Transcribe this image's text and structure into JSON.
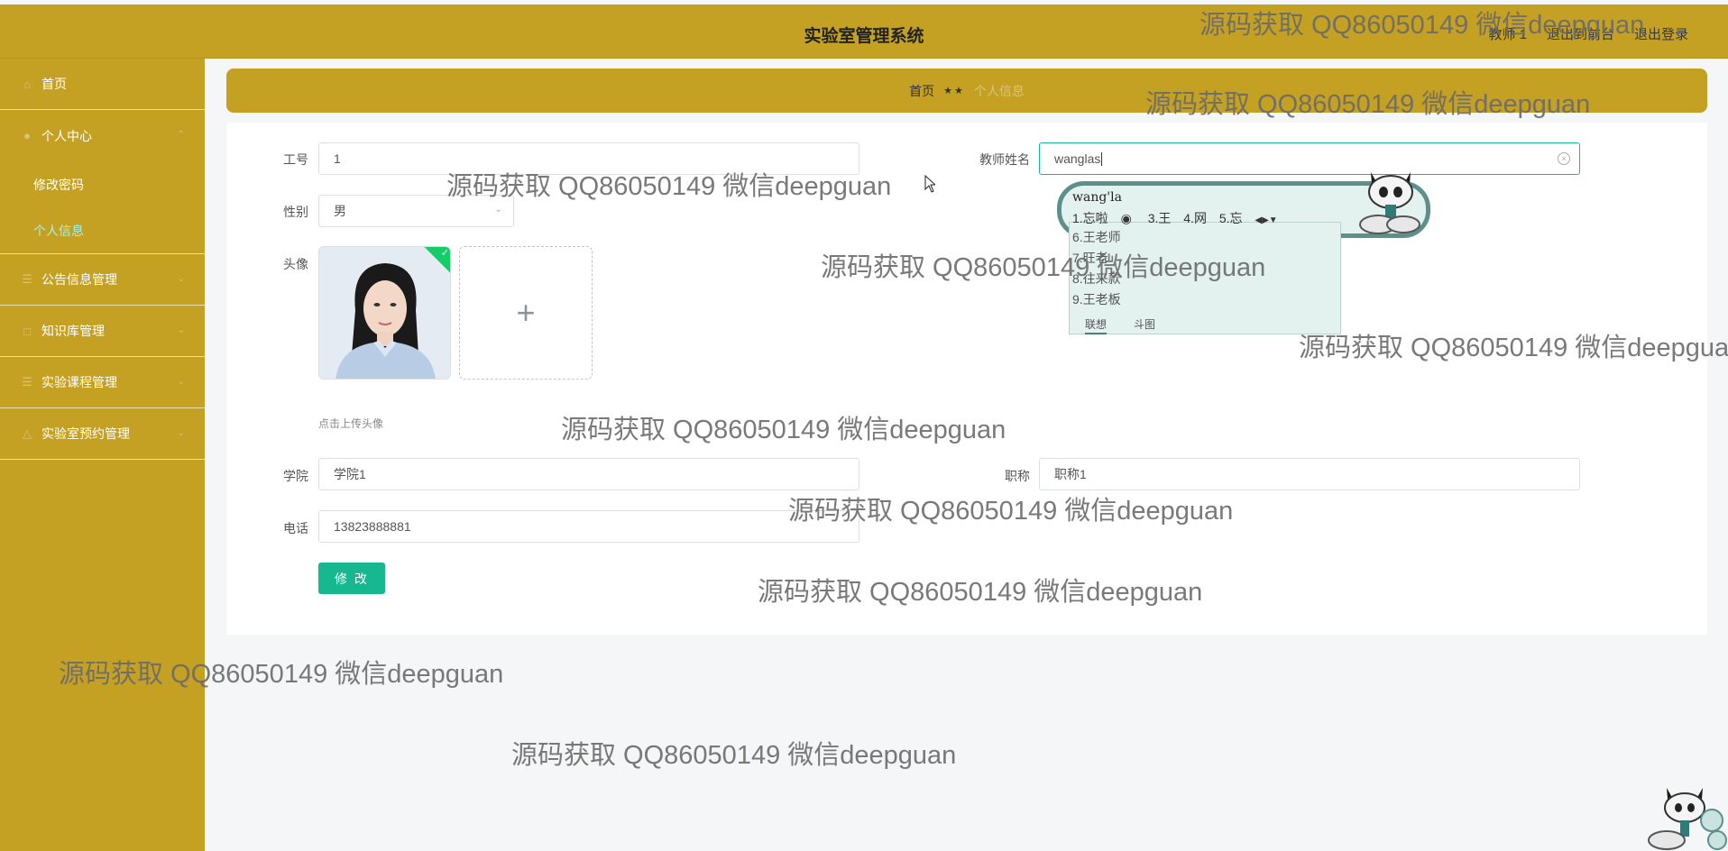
{
  "header": {
    "title": "实验室管理系统",
    "links": [
      "教师 1",
      "退出到前台",
      "退出登录"
    ]
  },
  "sidebar": {
    "items": [
      {
        "label": "首页",
        "icon": "home-icon"
      },
      {
        "label": "个人中心",
        "icon": "user-icon"
      },
      {
        "label": "公告信息管理",
        "icon": "list-icon"
      },
      {
        "label": "知识库管理",
        "icon": "book-icon"
      },
      {
        "label": "实验课程管理",
        "icon": "list-icon"
      },
      {
        "label": "实验室预约管理",
        "icon": "flask-icon"
      }
    ],
    "personal_sub": [
      "修改密码",
      "个人信息"
    ]
  },
  "breadcrumb": {
    "home": "首页",
    "separator": "★★",
    "current": "个人信息"
  },
  "form": {
    "id_label": "工号",
    "id_value": "1",
    "name_label": "教师姓名",
    "name_value": "wanglas",
    "gender_label": "性别",
    "gender_value": "男",
    "avatar_label": "头像",
    "upload_tip": "点击上传头像",
    "college_label": "学院",
    "college_value": "学院1",
    "title_label": "职称",
    "title_value": "职称1",
    "phone_label": "电话",
    "phone_value": "13823888881",
    "submit_label": "修 改"
  },
  "ime": {
    "pinyin": "wang'la",
    "first_row": [
      "1.忘啦",
      "3.王",
      "4.网",
      "5.忘"
    ],
    "candidates": [
      "6.王老师",
      "7.旺老",
      "8.往来款",
      "9.王老板"
    ],
    "tabs": [
      "联想",
      "斗图"
    ]
  },
  "watermark": "源码获取 QQ86050149 微信deepguan",
  "colors": {
    "theme": "#c4a122",
    "accent": "#17b890"
  }
}
